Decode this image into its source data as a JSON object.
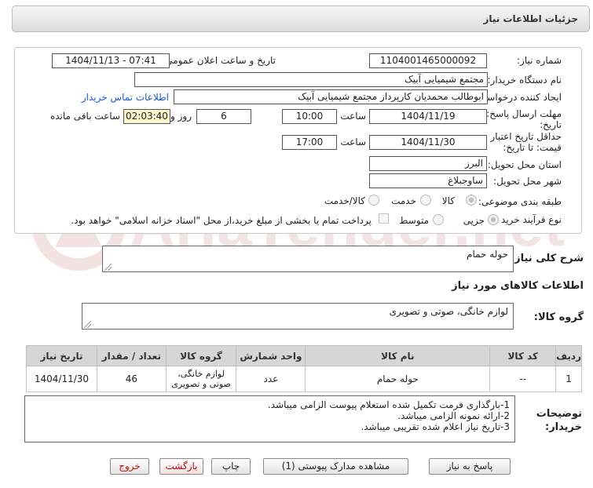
{
  "page": {
    "title": "جزئیات اطلاعات نیاز"
  },
  "fields": {
    "need_number": {
      "label": "شماره نیاز:",
      "value": "1104001465000092"
    },
    "announce_datetime": {
      "label": "تاریخ و ساعت اعلان عمومی:",
      "value": "1404/11/13 - 07:41"
    },
    "buyer_org": {
      "label": "نام دستگاه خریدار:",
      "value": "مجتمع شیمیایی آبیک"
    },
    "requester": {
      "label": "ایجاد کننده درخواست:",
      "value": "ابوطالب محمدیان کارپرداز مجتمع شیمیایی آبیک",
      "contact_link": "اطلاعات تماس خریدار"
    },
    "reply_deadline": {
      "label": "مهلت ارسال پاسخ: تا تاریخ:",
      "date": "1404/11/19",
      "time_label": "ساعت",
      "time": "10:00",
      "days": "6",
      "days_label": "روز و",
      "remaining": "02:03:40",
      "remaining_label": "ساعت باقی مانده"
    },
    "price_validity": {
      "label": "حداقل تاریخ اعتبار قیمت: تا تاریخ:",
      "date": "1404/11/30",
      "time_label": "ساعت",
      "time": "17:00"
    },
    "province": {
      "label": "استان محل تحویل:",
      "value": "البرز"
    },
    "city": {
      "label": "شهر محل تحویل:",
      "value": "ساوجبلاغ"
    },
    "category": {
      "label": "طبقه بندی موضوعی:",
      "options": [
        "کالا",
        "خدمت",
        "کالا/خدمت"
      ],
      "selected": "کالا"
    },
    "process_type": {
      "label": "نوع فرآیند خرید :",
      "options": [
        "جزیی",
        "متوسط"
      ],
      "selected": "جزیی",
      "payment_text": "پرداخت تمام یا بخشی از مبلغ خرید،از محل \"اسناد خزانه اسلامی\" خواهد بود."
    }
  },
  "summary": {
    "label": "شرح کلی نیاز:",
    "value": "حوله حمام"
  },
  "goods_section": {
    "title": "اطلاعات کالاهای مورد نیاز",
    "group_label": "گروه کالا:",
    "group_value": "لوازم خانگی، صوتی و تصویری"
  },
  "table": {
    "headers": [
      "ردیف",
      "کد کالا",
      "نام کالا",
      "واحد شمارش",
      "گروه کالا",
      "تعداد / مقدار",
      "تاریخ نیاز"
    ],
    "rows": [
      [
        "1",
        "--",
        "حوله حمام",
        "عدد",
        "لوازم خانگی، صوتی و تصویری",
        "46",
        "1404/11/30"
      ]
    ]
  },
  "notes": {
    "label": "توضیحات خریدار:",
    "lines": [
      "1-بارگذاری فرمت تکمیل شده استعلام پیوست الزامی میباشد.",
      "2-ارائه نمونه الزامی میباشد.",
      "3-تاریخ نیاز اعلام شده تقریبی میباشد."
    ]
  },
  "buttons": {
    "reply": "پاسخ به نیاز",
    "docs": "مشاهده مدارک پیوستی (1)",
    "print": "چاپ",
    "back": "بازگشت",
    "exit": "خروج"
  },
  "watermark": "AriaTender.net",
  "colors": {
    "link": "#1a5bc6",
    "highlight": "#fbf4c8",
    "header_bg": "#d6d6d6",
    "watermark": "#f1dede"
  }
}
